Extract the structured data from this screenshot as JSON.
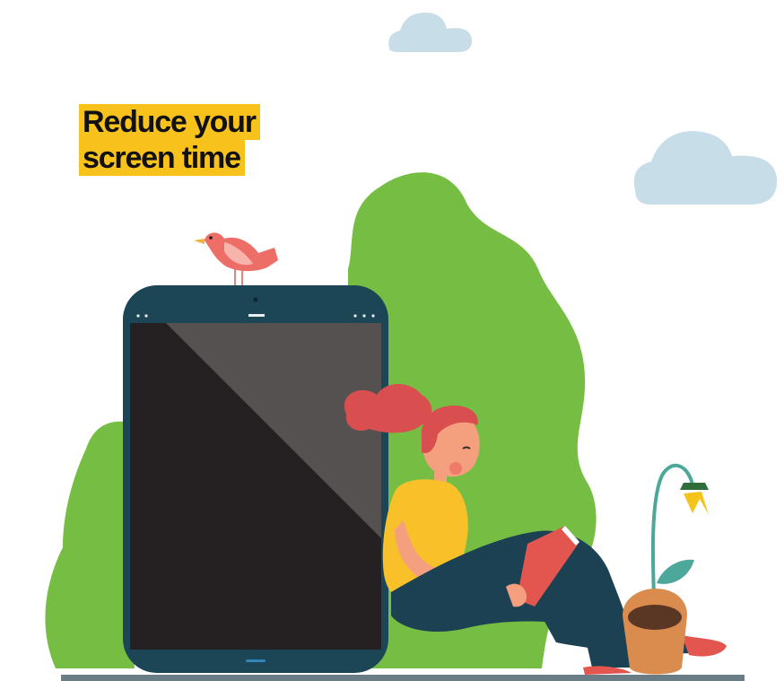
{
  "headline": {
    "line1": "Reduce your",
    "line2": "screen time"
  },
  "colors": {
    "highlight": "#f7c21b",
    "bush": "#76be43",
    "cloud": "#c7dde8",
    "tablet_frame": "#1c4556",
    "screen": "#252122",
    "hair": "#d94f4f",
    "shirt": "#f8c12a",
    "pants": "#1b4152",
    "skin": "#f4a07f",
    "book": "#e3564f",
    "bird": "#ec6e67",
    "pot": "#d98c4e",
    "flower": "#f6c31a",
    "ground": "#6a7c86"
  },
  "icons": [
    "cloud",
    "bird",
    "tablet",
    "woman-reading",
    "potted-flower"
  ]
}
